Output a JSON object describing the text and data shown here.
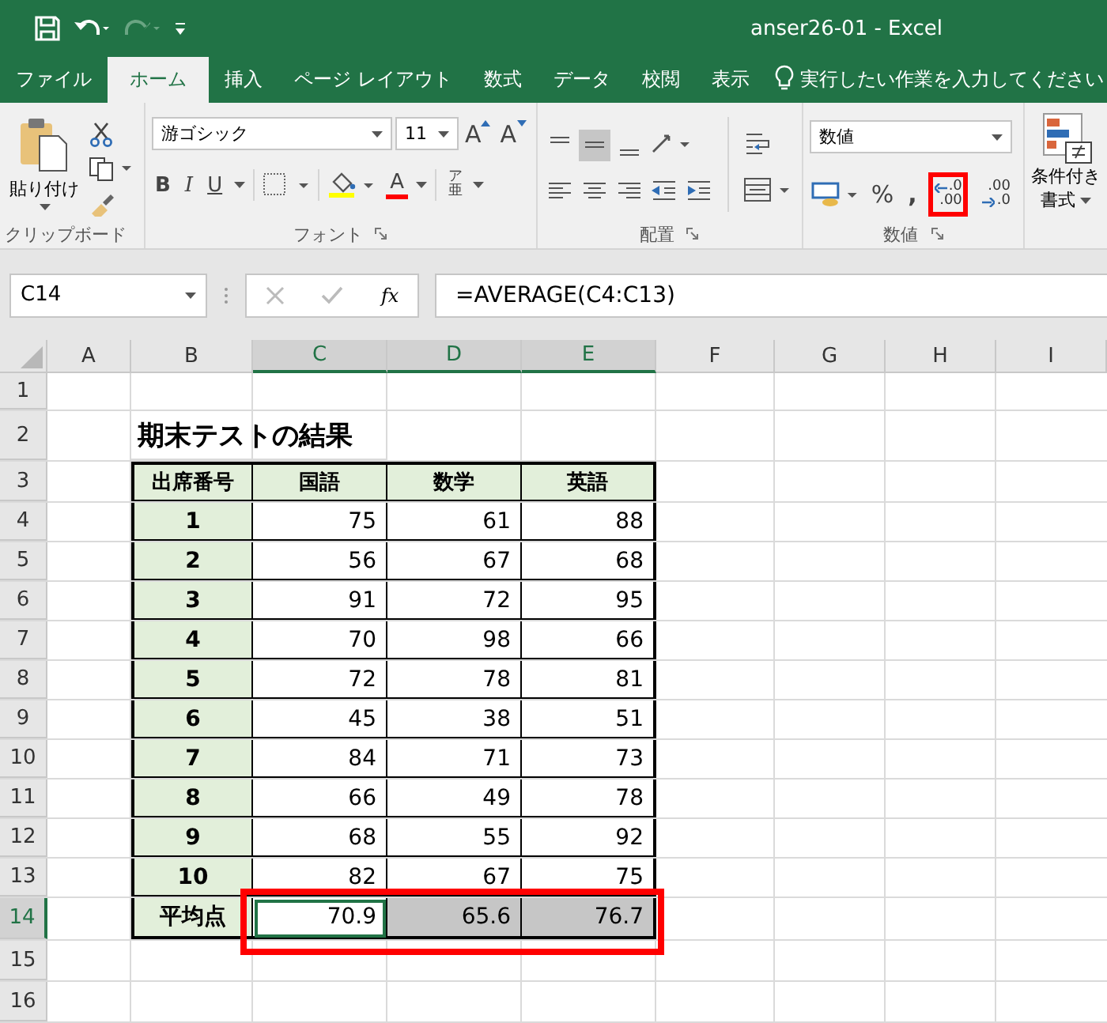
{
  "title_bar": {
    "document_title": "anser26-01  -  Excel"
  },
  "tabs": [
    {
      "label": "ファイル",
      "selected": false
    },
    {
      "label": "ホーム",
      "selected": true
    },
    {
      "label": "挿入",
      "selected": false
    },
    {
      "label": "ページ レイアウト",
      "selected": false
    },
    {
      "label": "数式",
      "selected": false
    },
    {
      "label": "データ",
      "selected": false
    },
    {
      "label": "校閲",
      "selected": false
    },
    {
      "label": "表示",
      "selected": false
    }
  ],
  "tell_me": "実行したい作業を入力してください",
  "ribbon": {
    "clipboard": {
      "paste": "貼り付け",
      "label": "クリップボード"
    },
    "font": {
      "font_name": "游ゴシック",
      "font_size": "11",
      "grow": "A",
      "shrink": "A",
      "bold": "B",
      "italic": "I",
      "underline": "U",
      "font_color": "A",
      "phonetic_top": "ア",
      "phonetic_bottom": "亜",
      "label": "フォント"
    },
    "alignment": {
      "label": "配置"
    },
    "number": {
      "format": "数値",
      "percent": "%",
      "comma": ",",
      "decrease_decimal": {
        "top": ".0",
        "bottom": ".00",
        "callout": true
      },
      "increase_decimal": {
        "top": ".00",
        "bottom": ".0",
        "callout": false
      },
      "label": "数値"
    },
    "styles": {
      "conditional_formatting": "条件付き",
      "conditional_formatting_2": "書式"
    }
  },
  "name_box": "C14",
  "fx": "fx",
  "formula": "=AVERAGE(C4:C13)",
  "columns": [
    {
      "label": "A",
      "selected": false
    },
    {
      "label": "B",
      "selected": false
    },
    {
      "label": "C",
      "selected": true
    },
    {
      "label": "D",
      "selected": true
    },
    {
      "label": "E",
      "selected": true
    },
    {
      "label": "F",
      "selected": false
    },
    {
      "label": "G",
      "selected": false
    },
    {
      "label": "H",
      "selected": false
    },
    {
      "label": "I",
      "selected": false
    }
  ],
  "row_headers": [
    {
      "label": "1",
      "selected": false
    },
    {
      "label": "2",
      "selected": false
    },
    {
      "label": "3",
      "selected": false
    },
    {
      "label": "4",
      "selected": false
    },
    {
      "label": "5",
      "selected": false
    },
    {
      "label": "6",
      "selected": false
    },
    {
      "label": "7",
      "selected": false
    },
    {
      "label": "8",
      "selected": false
    },
    {
      "label": "9",
      "selected": false
    },
    {
      "label": "10",
      "selected": false
    },
    {
      "label": "11",
      "selected": false
    },
    {
      "label": "12",
      "selected": false
    },
    {
      "label": "13",
      "selected": false
    },
    {
      "label": "14",
      "selected": true
    },
    {
      "label": "15",
      "selected": false
    },
    {
      "label": "16",
      "selected": false
    }
  ],
  "sheet": {
    "title": "期末テストの結果",
    "headers": [
      "出席番号",
      "国語",
      "数学",
      "英語"
    ],
    "rows": [
      {
        "number": "1",
        "values": [
          "75",
          "61",
          "88"
        ]
      },
      {
        "number": "2",
        "values": [
          "56",
          "67",
          "68"
        ]
      },
      {
        "number": "3",
        "values": [
          "91",
          "72",
          "95"
        ]
      },
      {
        "number": "4",
        "values": [
          "70",
          "98",
          "66"
        ]
      },
      {
        "number": "5",
        "values": [
          "72",
          "78",
          "81"
        ]
      },
      {
        "number": "6",
        "values": [
          "45",
          "38",
          "51"
        ]
      },
      {
        "number": "7",
        "values": [
          "84",
          "71",
          "73"
        ]
      },
      {
        "number": "8",
        "values": [
          "66",
          "49",
          "78"
        ]
      },
      {
        "number": "9",
        "values": [
          "68",
          "55",
          "92"
        ]
      },
      {
        "number": "10",
        "values": [
          "82",
          "67",
          "75"
        ]
      }
    ],
    "average": {
      "label": "平均点",
      "callout": true,
      "cells": [
        {
          "value": "70.9",
          "selected": true,
          "active": true
        },
        {
          "value": "65.6",
          "selected": true,
          "active": false
        },
        {
          "value": "76.7",
          "selected": true,
          "active": false
        }
      ]
    }
  }
}
